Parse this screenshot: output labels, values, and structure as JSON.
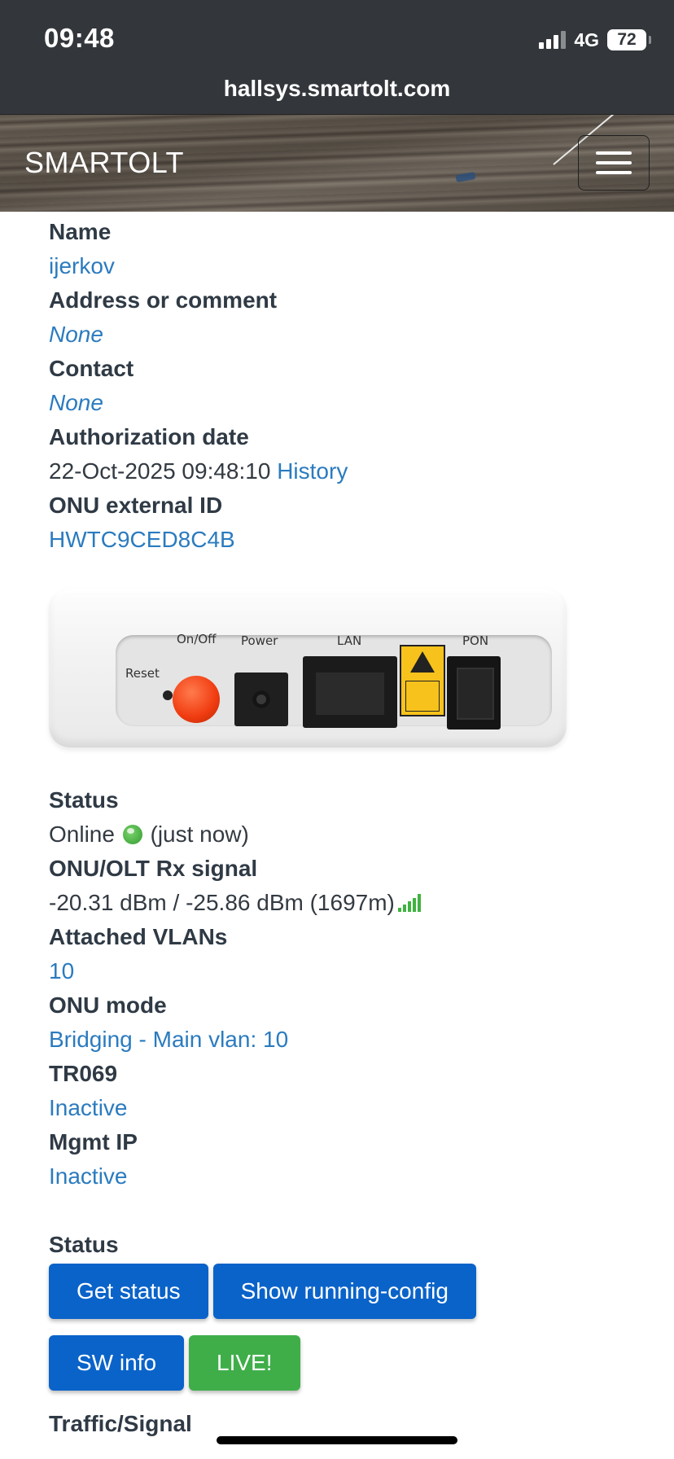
{
  "status_bar": {
    "time": "09:48",
    "network": "4G",
    "battery": "72"
  },
  "browser": {
    "url": "hallsys.smartolt.com"
  },
  "navbar": {
    "brand": "SMARTOLT",
    "menu_icon": "hamburger-menu-icon"
  },
  "onu": {
    "name_label": "Name",
    "name": "ijerkov",
    "address_label": "Address or comment",
    "address": "None",
    "contact_label": "Contact",
    "contact": "None",
    "auth_date_label": "Authorization date",
    "auth_date": "22-Oct-2025 09:48:10",
    "history_link": "History",
    "external_id_label": "ONU external ID",
    "external_id": "HWTC9CED8C4B"
  },
  "device_image": {
    "labels": {
      "reset": "Reset",
      "onoff": "On/Off",
      "power": "Power",
      "lan": "LAN",
      "pon": "PON"
    }
  },
  "details": {
    "status_label": "Status",
    "status": "Online",
    "status_icon": "globe-icon",
    "status_time": "(just now)",
    "signal_label": "ONU/OLT Rx signal",
    "signal": "-20.31 dBm / -25.86 dBm (1697m)",
    "signal_icon": "signal-strength-icon",
    "vlans_label": "Attached VLANs",
    "vlans": "10",
    "mode_label": "ONU mode",
    "mode": "Bridging - Main vlan: 10",
    "tr069_label": "TR069",
    "tr069": "Inactive",
    "mgmt_ip_label": "Mgmt IP",
    "mgmt_ip": "Inactive"
  },
  "actions": {
    "section_label": "Status",
    "get_status": "Get status",
    "show_running_config": "Show running-config",
    "sw_info": "SW info",
    "live": "LIVE!",
    "colors": {
      "primary": "#0a63c9",
      "success": "#3fae49"
    }
  },
  "next_section": {
    "label": "Traffic/Signal"
  },
  "colors": {
    "link": "#2b7bbf",
    "topbar": "#33373b"
  }
}
